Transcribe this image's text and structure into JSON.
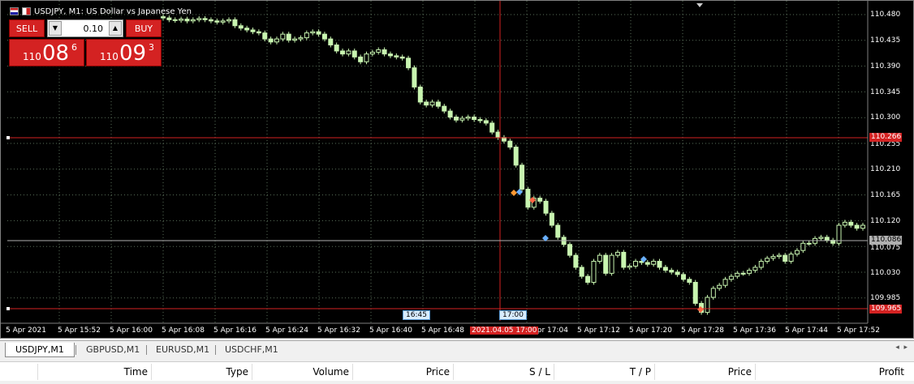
{
  "chart": {
    "title": "USDJPY, M1:  US Dollar vs Japanese Yen",
    "flag_icon": "us-jp-flag-icon",
    "colors": {
      "background": "#000000",
      "candle": "#c8f5b0",
      "crosshair": "#d42222",
      "grid": "#5a6f5a"
    }
  },
  "trade_panel": {
    "sell_label": "SELL",
    "buy_label": "BUY",
    "lot": "0.10",
    "sell_price": {
      "prefix": "110",
      "big": "08",
      "sup": "6"
    },
    "buy_price": {
      "prefix": "110",
      "big": "09",
      "sup": "3"
    }
  },
  "price_axis": {
    "labels": [
      "110.480",
      "110.435",
      "110.390",
      "110.345",
      "110.300",
      "110.255",
      "110.210",
      "110.165",
      "110.120",
      "110.075",
      "110.030",
      "109.985"
    ],
    "upper_line": "110.266",
    "bid": "110.086",
    "lower_line": "109.965"
  },
  "time_axis": {
    "labels": [
      "5 Apr 2021",
      "5 Apr 15:52",
      "5 Apr 16:00",
      "5 Apr 16:08",
      "5 Apr 16:16",
      "5 Apr 16:24",
      "5 Apr 16:32",
      "5 Apr 16:40",
      "5 Apr 16:48",
      "5 Apr 17:04",
      "5 Apr 17:12",
      "5 Apr 17:20",
      "5 Apr 17:28",
      "5 Apr 17:36",
      "5 Apr 17:44",
      "5 Apr 17:52"
    ],
    "crosshair_time": "2021.04.05 17:00",
    "sep_a": "16:45",
    "sep_b": "17:00"
  },
  "tabs": [
    {
      "label": "USDJPY,M1",
      "active": true
    },
    {
      "label": "GBPUSD,M1"
    },
    {
      "label": "EURUSD,M1"
    },
    {
      "label": "USDCHF,M1"
    }
  ],
  "terminal": {
    "columns": [
      "Time",
      "Type",
      "Volume",
      "Price",
      "S / L",
      "T / P",
      "Price",
      "Profit"
    ]
  },
  "chart_data": {
    "type": "candlestick",
    "ylim": [
      109.965,
      110.48
    ],
    "close": [
      110.465,
      110.462,
      110.461,
      110.463,
      110.46,
      110.462,
      110.464,
      110.462,
      110.46,
      110.458,
      110.46,
      110.462,
      110.452,
      110.448,
      110.445,
      110.442,
      110.44,
      110.43,
      110.425,
      110.43,
      110.438,
      110.428,
      110.43,
      110.432,
      110.44,
      110.442,
      110.438,
      110.43,
      110.42,
      110.41,
      110.405,
      110.41,
      110.4,
      110.392,
      110.405,
      110.408,
      110.412,
      110.405,
      110.402,
      110.4,
      110.398,
      110.382,
      110.35,
      110.325,
      110.32,
      110.325,
      110.318,
      110.31,
      110.3,
      110.295,
      110.298,
      110.3,
      110.296,
      110.294,
      110.29,
      110.275,
      110.266,
      110.26,
      110.25,
      110.22,
      110.18,
      110.15,
      110.165,
      110.16,
      110.14,
      110.12,
      110.1,
      110.088,
      110.07,
      110.05,
      110.035,
      110.025,
      110.06,
      110.07,
      110.04,
      110.07,
      110.075,
      110.05,
      110.052,
      110.06,
      110.058,
      110.055,
      110.06,
      110.05,
      110.045,
      110.042,
      110.038,
      110.03,
      110.025,
      109.99,
      109.975,
      110.0,
      110.015,
      110.02,
      110.03,
      110.035,
      110.04,
      110.04,
      110.045,
      110.05,
      110.06,
      110.065,
      110.068,
      110.07,
      110.06,
      110.072,
      110.078,
      110.09,
      110.09,
      110.098,
      110.1,
      110.095,
      110.09,
      110.12,
      110.125,
      110.12,
      110.115,
      110.12
    ]
  }
}
